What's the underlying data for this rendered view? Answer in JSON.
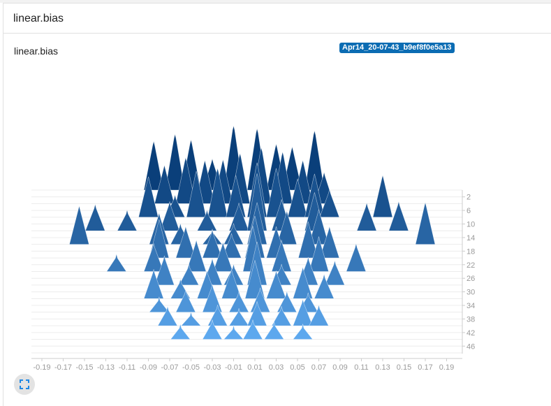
{
  "header": {
    "title": "linear.bias"
  },
  "card": {
    "title": "linear.bias",
    "run": "Apr14_20-07-43_b9ef8f0e5a13"
  },
  "icons": {
    "fullscreen": "fullscreen-icon"
  },
  "colors": {
    "back": "#0a3f7a",
    "front": "#5da8ee",
    "badge": "#0b6cb3",
    "axis": "#cccccc",
    "tick": "#9a9a9a"
  },
  "chart_data": {
    "type": "area",
    "x_ticks": [
      -0.19,
      -0.17,
      -0.15,
      -0.13,
      -0.11,
      -0.09,
      -0.07,
      -0.05,
      -0.03,
      -0.01,
      0.01,
      0.03,
      0.05,
      0.07,
      0.09,
      0.11,
      0.13,
      0.15,
      0.17,
      0.19
    ],
    "y_ticks": [
      2,
      6,
      10,
      14,
      18,
      22,
      26,
      30,
      34,
      38,
      42,
      46
    ],
    "xlim": [
      -0.2,
      0.2
    ],
    "steps": [
      0,
      48
    ],
    "grid": false,
    "series": [
      {
        "step": 0,
        "peaks": [
          {
            "x": -0.085,
            "h": 0.7
          },
          {
            "x": -0.065,
            "h": 0.8
          },
          {
            "x": -0.05,
            "h": 0.72
          },
          {
            "x": -0.03,
            "h": 0.45
          },
          {
            "x": -0.01,
            "h": 0.92
          },
          {
            "x": 0.012,
            "h": 0.88
          },
          {
            "x": 0.03,
            "h": 0.66
          },
          {
            "x": 0.045,
            "h": 0.62
          },
          {
            "x": 0.066,
            "h": 0.85
          }
        ]
      },
      {
        "step": 4,
        "peaks": [
          {
            "x": -0.075,
            "h": 0.55
          },
          {
            "x": -0.055,
            "h": 0.66
          },
          {
            "x": -0.037,
            "h": 0.62
          },
          {
            "x": -0.02,
            "h": 0.63
          },
          {
            "x": -0.004,
            "h": 0.72
          },
          {
            "x": 0.016,
            "h": 0.8
          },
          {
            "x": 0.036,
            "h": 0.74
          },
          {
            "x": 0.055,
            "h": 0.62
          },
          {
            "x": 0.075,
            "h": 0.45
          }
        ]
      },
      {
        "step": 8,
        "peaks": [
          {
            "x": -0.09,
            "h": 0.58
          },
          {
            "x": -0.065,
            "h": 0.32
          },
          {
            "x": -0.045,
            "h": 0.66
          },
          {
            "x": -0.025,
            "h": 0.7
          },
          {
            "x": -0.008,
            "h": 0.6
          },
          {
            "x": 0.012,
            "h": 0.78
          },
          {
            "x": 0.03,
            "h": 0.7
          },
          {
            "x": 0.05,
            "h": 0.55
          },
          {
            "x": 0.066,
            "h": 0.62
          },
          {
            "x": 0.08,
            "h": 0.4
          },
          {
            "x": 0.13,
            "h": 0.6
          }
        ]
      },
      {
        "step": 12,
        "peaks": [
          {
            "x": -0.14,
            "h": 0.38
          },
          {
            "x": -0.11,
            "h": 0.3
          },
          {
            "x": -0.07,
            "h": 0.42
          },
          {
            "x": -0.035,
            "h": 0.3
          },
          {
            "x": -0.005,
            "h": 0.4
          },
          {
            "x": 0.012,
            "h": 0.82
          },
          {
            "x": 0.035,
            "h": 0.45
          },
          {
            "x": 0.066,
            "h": 0.55
          },
          {
            "x": 0.115,
            "h": 0.4
          },
          {
            "x": 0.145,
            "h": 0.42
          }
        ]
      },
      {
        "step": 16,
        "peaks": [
          {
            "x": -0.155,
            "h": 0.55
          },
          {
            "x": -0.08,
            "h": 0.45
          },
          {
            "x": -0.06,
            "h": 0.3
          },
          {
            "x": -0.03,
            "h": 0.22
          },
          {
            "x": -0.01,
            "h": 0.3
          },
          {
            "x": 0.012,
            "h": 0.6
          },
          {
            "x": 0.04,
            "h": 0.48
          },
          {
            "x": 0.07,
            "h": 0.5
          },
          {
            "x": 0.17,
            "h": 0.6
          }
        ]
      },
      {
        "step": 20,
        "peaks": [
          {
            "x": -0.08,
            "h": 0.55
          },
          {
            "x": -0.055,
            "h": 0.45
          },
          {
            "x": -0.03,
            "h": 0.4
          },
          {
            "x": -0.012,
            "h": 0.35
          },
          {
            "x": 0.01,
            "h": 0.6
          },
          {
            "x": 0.03,
            "h": 0.45
          },
          {
            "x": 0.06,
            "h": 0.52
          },
          {
            "x": 0.08,
            "h": 0.45
          }
        ]
      },
      {
        "step": 24,
        "peaks": [
          {
            "x": -0.12,
            "h": 0.25
          },
          {
            "x": -0.085,
            "h": 0.4
          },
          {
            "x": -0.045,
            "h": 0.45
          },
          {
            "x": -0.02,
            "h": 0.42
          },
          {
            "x": 0.008,
            "h": 0.65
          },
          {
            "x": 0.035,
            "h": 0.45
          },
          {
            "x": 0.07,
            "h": 0.5
          },
          {
            "x": 0.105,
            "h": 0.4
          }
        ]
      },
      {
        "step": 28,
        "peaks": [
          {
            "x": -0.075,
            "h": 0.42
          },
          {
            "x": -0.052,
            "h": 0.3
          },
          {
            "x": -0.03,
            "h": 0.38
          },
          {
            "x": -0.01,
            "h": 0.3
          },
          {
            "x": 0.012,
            "h": 0.62
          },
          {
            "x": 0.035,
            "h": 0.3
          },
          {
            "x": 0.06,
            "h": 0.4
          },
          {
            "x": 0.085,
            "h": 0.35
          }
        ]
      },
      {
        "step": 32,
        "peaks": [
          {
            "x": -0.085,
            "h": 0.42
          },
          {
            "x": -0.06,
            "h": 0.28
          },
          {
            "x": -0.035,
            "h": 0.4
          },
          {
            "x": -0.012,
            "h": 0.42
          },
          {
            "x": 0.01,
            "h": 0.55
          },
          {
            "x": 0.03,
            "h": 0.4
          },
          {
            "x": 0.055,
            "h": 0.45
          },
          {
            "x": 0.075,
            "h": 0.35
          }
        ]
      },
      {
        "step": 36,
        "peaks": [
          {
            "x": -0.08,
            "h": 0.22
          },
          {
            "x": -0.055,
            "h": 0.32
          },
          {
            "x": -0.03,
            "h": 0.4
          },
          {
            "x": -0.005,
            "h": 0.3
          },
          {
            "x": 0.015,
            "h": 0.35
          },
          {
            "x": 0.04,
            "h": 0.3
          },
          {
            "x": 0.06,
            "h": 0.28
          }
        ]
      },
      {
        "step": 40,
        "peaks": [
          {
            "x": -0.072,
            "h": 0.28
          },
          {
            "x": -0.05,
            "h": 0.2
          },
          {
            "x": -0.025,
            "h": 0.3
          },
          {
            "x": -0.005,
            "h": 0.25
          },
          {
            "x": 0.012,
            "h": 0.35
          },
          {
            "x": 0.035,
            "h": 0.28
          },
          {
            "x": 0.055,
            "h": 0.38
          },
          {
            "x": 0.07,
            "h": 0.3
          }
        ]
      },
      {
        "step": 44,
        "peaks": [
          {
            "x": -0.06,
            "h": 0.22
          },
          {
            "x": -0.03,
            "h": 0.28
          },
          {
            "x": -0.01,
            "h": 0.2
          },
          {
            "x": 0.008,
            "h": 0.28
          },
          {
            "x": 0.028,
            "h": 0.25
          },
          {
            "x": 0.055,
            "h": 0.22
          }
        ]
      }
    ]
  }
}
